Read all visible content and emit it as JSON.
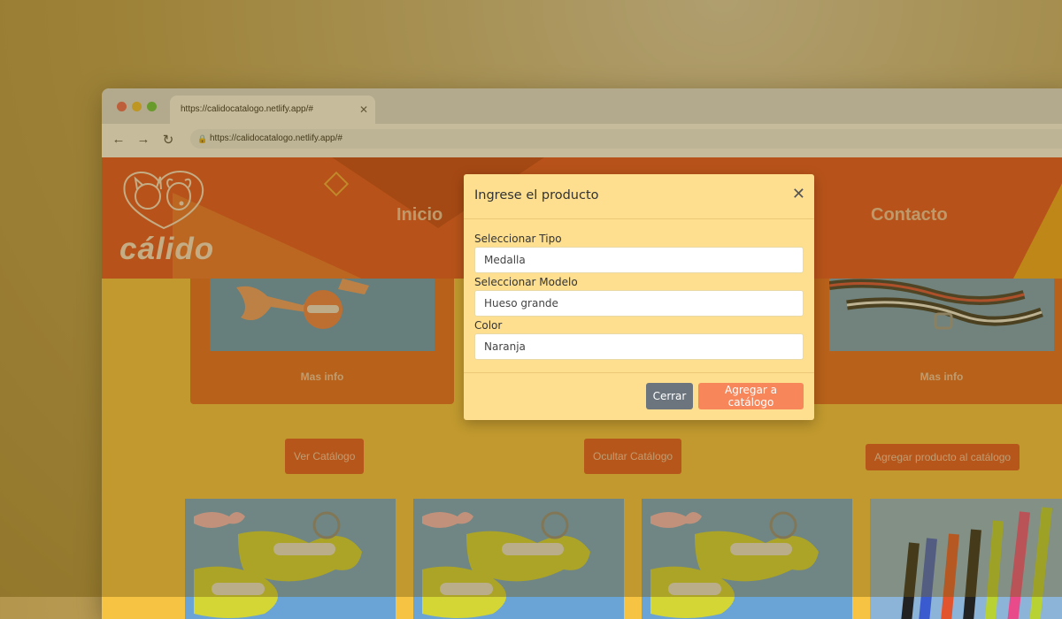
{
  "browser": {
    "tab_title": "https://calidocatalogo.netlify.app/#",
    "address": "https://calidocatalogo.netlify.app/#"
  },
  "site": {
    "logo_text": "cálido",
    "nav": [
      "Inicio",
      "Contacto"
    ]
  },
  "cards": [
    {
      "link": "Mas info"
    },
    {
      "link": "Mas info"
    }
  ],
  "buttons": {
    "ver": "Ver Catálogo",
    "ocultar": "Ocultar Catálogo",
    "agregar": "Agregar producto al catálogo"
  },
  "modal": {
    "title": "Ingrese el producto",
    "fields": [
      {
        "label": "Seleccionar Tipo",
        "value": "Medalla"
      },
      {
        "label": "Seleccionar Modelo",
        "value": "Hueso grande"
      },
      {
        "label": "Color",
        "value": "Naranja"
      }
    ],
    "close_label": "Cerrar",
    "add_label": "Agregar a catálogo"
  }
}
